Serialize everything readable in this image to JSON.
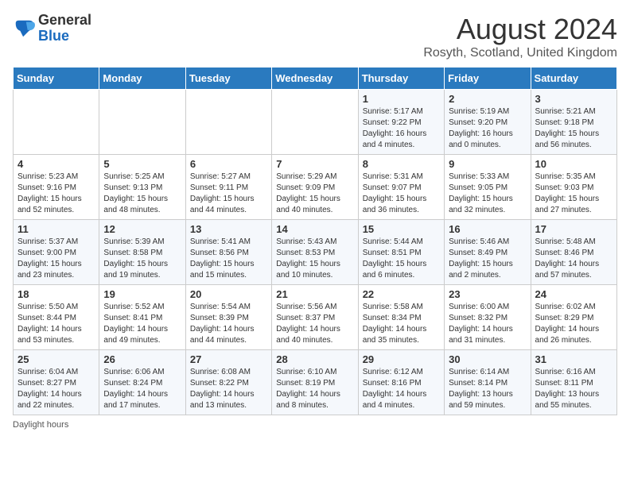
{
  "header": {
    "logo_general": "General",
    "logo_blue": "Blue",
    "title": "August 2024",
    "subtitle": "Rosyth, Scotland, United Kingdom"
  },
  "days_of_week": [
    "Sunday",
    "Monday",
    "Tuesday",
    "Wednesday",
    "Thursday",
    "Friday",
    "Saturday"
  ],
  "weeks": [
    [
      {
        "day": "",
        "info": ""
      },
      {
        "day": "",
        "info": ""
      },
      {
        "day": "",
        "info": ""
      },
      {
        "day": "",
        "info": ""
      },
      {
        "day": "1",
        "info": "Sunrise: 5:17 AM\nSunset: 9:22 PM\nDaylight: 16 hours\nand 4 minutes."
      },
      {
        "day": "2",
        "info": "Sunrise: 5:19 AM\nSunset: 9:20 PM\nDaylight: 16 hours\nand 0 minutes."
      },
      {
        "day": "3",
        "info": "Sunrise: 5:21 AM\nSunset: 9:18 PM\nDaylight: 15 hours\nand 56 minutes."
      }
    ],
    [
      {
        "day": "4",
        "info": "Sunrise: 5:23 AM\nSunset: 9:16 PM\nDaylight: 15 hours\nand 52 minutes."
      },
      {
        "day": "5",
        "info": "Sunrise: 5:25 AM\nSunset: 9:13 PM\nDaylight: 15 hours\nand 48 minutes."
      },
      {
        "day": "6",
        "info": "Sunrise: 5:27 AM\nSunset: 9:11 PM\nDaylight: 15 hours\nand 44 minutes."
      },
      {
        "day": "7",
        "info": "Sunrise: 5:29 AM\nSunset: 9:09 PM\nDaylight: 15 hours\nand 40 minutes."
      },
      {
        "day": "8",
        "info": "Sunrise: 5:31 AM\nSunset: 9:07 PM\nDaylight: 15 hours\nand 36 minutes."
      },
      {
        "day": "9",
        "info": "Sunrise: 5:33 AM\nSunset: 9:05 PM\nDaylight: 15 hours\nand 32 minutes."
      },
      {
        "day": "10",
        "info": "Sunrise: 5:35 AM\nSunset: 9:03 PM\nDaylight: 15 hours\nand 27 minutes."
      }
    ],
    [
      {
        "day": "11",
        "info": "Sunrise: 5:37 AM\nSunset: 9:00 PM\nDaylight: 15 hours\nand 23 minutes."
      },
      {
        "day": "12",
        "info": "Sunrise: 5:39 AM\nSunset: 8:58 PM\nDaylight: 15 hours\nand 19 minutes."
      },
      {
        "day": "13",
        "info": "Sunrise: 5:41 AM\nSunset: 8:56 PM\nDaylight: 15 hours\nand 15 minutes."
      },
      {
        "day": "14",
        "info": "Sunrise: 5:43 AM\nSunset: 8:53 PM\nDaylight: 15 hours\nand 10 minutes."
      },
      {
        "day": "15",
        "info": "Sunrise: 5:44 AM\nSunset: 8:51 PM\nDaylight: 15 hours\nand 6 minutes."
      },
      {
        "day": "16",
        "info": "Sunrise: 5:46 AM\nSunset: 8:49 PM\nDaylight: 15 hours\nand 2 minutes."
      },
      {
        "day": "17",
        "info": "Sunrise: 5:48 AM\nSunset: 8:46 PM\nDaylight: 14 hours\nand 57 minutes."
      }
    ],
    [
      {
        "day": "18",
        "info": "Sunrise: 5:50 AM\nSunset: 8:44 PM\nDaylight: 14 hours\nand 53 minutes."
      },
      {
        "day": "19",
        "info": "Sunrise: 5:52 AM\nSunset: 8:41 PM\nDaylight: 14 hours\nand 49 minutes."
      },
      {
        "day": "20",
        "info": "Sunrise: 5:54 AM\nSunset: 8:39 PM\nDaylight: 14 hours\nand 44 minutes."
      },
      {
        "day": "21",
        "info": "Sunrise: 5:56 AM\nSunset: 8:37 PM\nDaylight: 14 hours\nand 40 minutes."
      },
      {
        "day": "22",
        "info": "Sunrise: 5:58 AM\nSunset: 8:34 PM\nDaylight: 14 hours\nand 35 minutes."
      },
      {
        "day": "23",
        "info": "Sunrise: 6:00 AM\nSunset: 8:32 PM\nDaylight: 14 hours\nand 31 minutes."
      },
      {
        "day": "24",
        "info": "Sunrise: 6:02 AM\nSunset: 8:29 PM\nDaylight: 14 hours\nand 26 minutes."
      }
    ],
    [
      {
        "day": "25",
        "info": "Sunrise: 6:04 AM\nSunset: 8:27 PM\nDaylight: 14 hours\nand 22 minutes."
      },
      {
        "day": "26",
        "info": "Sunrise: 6:06 AM\nSunset: 8:24 PM\nDaylight: 14 hours\nand 17 minutes."
      },
      {
        "day": "27",
        "info": "Sunrise: 6:08 AM\nSunset: 8:22 PM\nDaylight: 14 hours\nand 13 minutes."
      },
      {
        "day": "28",
        "info": "Sunrise: 6:10 AM\nSunset: 8:19 PM\nDaylight: 14 hours\nand 8 minutes."
      },
      {
        "day": "29",
        "info": "Sunrise: 6:12 AM\nSunset: 8:16 PM\nDaylight: 14 hours\nand 4 minutes."
      },
      {
        "day": "30",
        "info": "Sunrise: 6:14 AM\nSunset: 8:14 PM\nDaylight: 13 hours\nand 59 minutes."
      },
      {
        "day": "31",
        "info": "Sunrise: 6:16 AM\nSunset: 8:11 PM\nDaylight: 13 hours\nand 55 minutes."
      }
    ]
  ],
  "footer": {
    "daylight_label": "Daylight hours"
  }
}
